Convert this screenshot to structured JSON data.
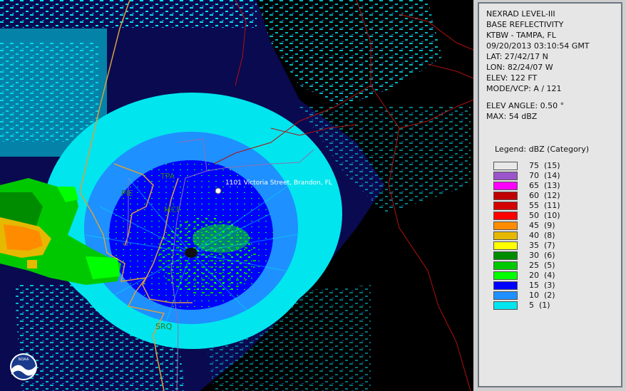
{
  "header": {
    "lines": [
      "NEXRAD LEVEL-III",
      "BASE REFLECTIVITY",
      "KTBW - TAMPA, FL",
      "09/20/2013 03:10:54 GMT",
      "LAT: 27/42/17 N",
      "LON: 82/24/07 W",
      "ELEV: 122 FT",
      "MODE/VCP: A / 121"
    ],
    "elev_angle": "ELEV ANGLE: 0.50 °",
    "max": "MAX: 54 dBZ"
  },
  "legend": {
    "title": "Legend: dBZ (Category)",
    "items": [
      {
        "label": "75  (15)",
        "color": "#e8e8e8"
      },
      {
        "label": "70  (14)",
        "color": "#9955c9"
      },
      {
        "label": "65  (13)",
        "color": "#ff00ff"
      },
      {
        "label": "60  (12)",
        "color": "#c00000"
      },
      {
        "label": "55  (11)",
        "color": "#d40000"
      },
      {
        "label": "50  (10)",
        "color": "#ff0000"
      },
      {
        "label": "45  (9)",
        "color": "#ff8c00"
      },
      {
        "label": "40  (8)",
        "color": "#e6b800"
      },
      {
        "label": "35  (7)",
        "color": "#ffff00"
      },
      {
        "label": "30  (6)",
        "color": "#008c00"
      },
      {
        "label": "25  (5)",
        "color": "#00c800"
      },
      {
        "label": "20  (4)",
        "color": "#00ff00"
      },
      {
        "label": "15  (3)",
        "color": "#0000ff"
      },
      {
        "label": "10  (2)",
        "color": "#1e90ff"
      },
      {
        "label": "5  (1)",
        "color": "#00e5ee"
      }
    ]
  },
  "map": {
    "address": "1101 Victoria Street, Brandon, FL",
    "labels": [
      "TPA",
      "PIE",
      "MCF",
      "SRQ"
    ],
    "logo_text": "NOAA"
  }
}
